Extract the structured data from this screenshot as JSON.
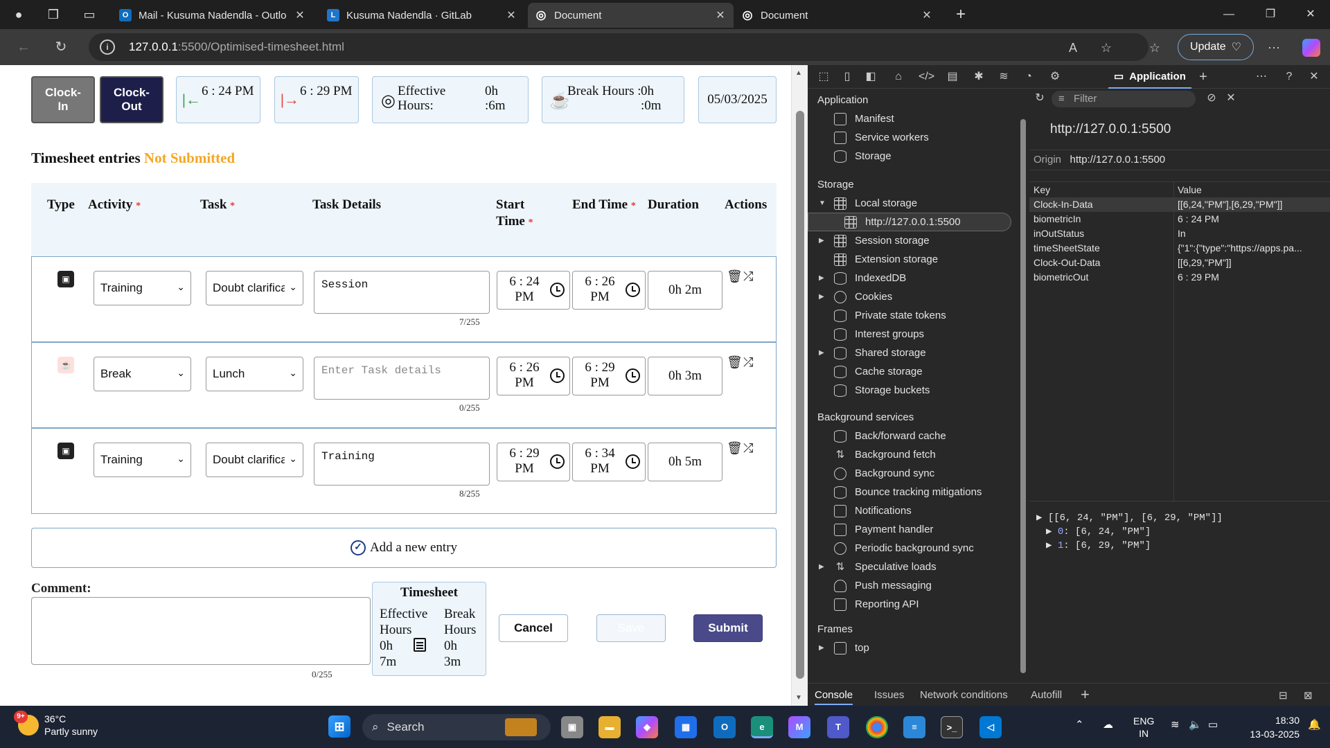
{
  "browser": {
    "tabs": [
      {
        "title": "Mail - Kusuma Nadendla - Outlook",
        "color": "#0f6cbd",
        "glyph": "O"
      },
      {
        "title": "Kusuma Nadendla · GitLab",
        "color": "#1f75cb",
        "glyph": "L"
      },
      {
        "title": "Document",
        "color": "#555555",
        "glyph": "◎"
      },
      {
        "title": "Document",
        "color": "#555555",
        "glyph": "◎"
      }
    ],
    "url_host": "127.0.0.1",
    "url_rest": ":5500/Optimised-timesheet.html",
    "update_label": "Update"
  },
  "page": {
    "clock_in_label": "Clock-In",
    "clock_out_label": "Clock-Out",
    "clock_in_time": "6 : 24 PM",
    "clock_out_time": "6 : 29 PM",
    "effective_label": "Effective Hours:",
    "effective_h": "0h",
    "effective_m": ":6m",
    "break_label": "Break Hours :",
    "break_h": "0h",
    "break_m": ":0m",
    "date": "05/03/2025",
    "timesheet_title": "Timesheet entries",
    "timesheet_status": "Not Submitted",
    "columns": {
      "type": "Type",
      "activity": "Activity",
      "task": "Task",
      "details": "Task Details",
      "start_1": "Start",
      "start_2": "Time",
      "end": "End Time",
      "duration": "Duration",
      "actions": "Actions"
    },
    "required_mark": "*",
    "rows": [
      {
        "activity": "Training",
        "task": "Doubt clarification",
        "details": "Session",
        "details_placeholder": "",
        "count": "7/255",
        "start_1": "6 : 24",
        "start_2": "PM",
        "end_1": "6 : 26",
        "end_2": "PM",
        "duration": "0h 2m"
      },
      {
        "activity": "Break",
        "task": "Lunch",
        "details": "",
        "details_placeholder": "Enter Task details",
        "count": "0/255",
        "start_1": "6 : 26",
        "start_2": "PM",
        "end_1": "6 : 29",
        "end_2": "PM",
        "duration": "0h 3m"
      },
      {
        "activity": "Training",
        "task": "Doubt clarification",
        "details": "Training",
        "details_placeholder": "",
        "count": "8/255",
        "start_1": "6 : 29",
        "start_2": "PM",
        "end_1": "6 : 34",
        "end_2": "PM",
        "duration": "0h 5m"
      }
    ],
    "add_entry_label": "Add a new entry",
    "comment_label": "Comment:",
    "comment_count": "0/255",
    "summary": {
      "title": "Timesheet",
      "eff_1": "Effective",
      "eff_2": "Hours",
      "eff_3": "0h",
      "eff_4": "7m",
      "brk_1": "Break",
      "brk_2": "Hours",
      "brk_3": "0h",
      "brk_4": "3m"
    },
    "cancel_label": "Cancel",
    "save_label": "Save",
    "submit_label": "Submit"
  },
  "devtools": {
    "active_tab": "Application",
    "sidebar": {
      "application_header": "Application",
      "application_items": [
        "Manifest",
        "Service workers",
        "Storage"
      ],
      "storage_header": "Storage",
      "local_storage": "Local storage",
      "local_storage_origin": "http://127.0.0.1:5500",
      "storage_items": [
        "Session storage",
        "Extension storage",
        "IndexedDB",
        "Cookies",
        "Private state tokens",
        "Interest groups",
        "Shared storage",
        "Cache storage",
        "Storage buckets"
      ],
      "bg_header": "Background services",
      "bg_items": [
        "Back/forward cache",
        "Background fetch",
        "Background sync",
        "Bounce tracking mitigations",
        "Notifications",
        "Payment handler",
        "Periodic background sync",
        "Speculative loads",
        "Push messaging",
        "Reporting API"
      ],
      "frames_header": "Frames",
      "frames_top": "top"
    },
    "filter_placeholder": "Filter",
    "origin_title": "http://127.0.0.1:5500",
    "origin_label": "Origin",
    "origin_value": "http://127.0.0.1:5500",
    "table": {
      "key_header": "Key",
      "value_header": "Value",
      "rows": [
        {
          "key": "Clock-In-Data",
          "value": "[[6,24,\"PM\"],[6,29,\"PM\"]]"
        },
        {
          "key": "biometricIn",
          "value": "6 : 24 PM"
        },
        {
          "key": "inOutStatus",
          "value": "In"
        },
        {
          "key": "timeSheetState",
          "value": "{\"1\":{\"type\":\"https://apps.pa..."
        },
        {
          "key": "Clock-Out-Data",
          "value": "[[6,29,\"PM\"]]"
        },
        {
          "key": "biometricOut",
          "value": "6 : 29 PM"
        }
      ]
    },
    "preview": {
      "line1": "[[6, 24, \"PM\"], [6, 29, \"PM\"]]",
      "idx0": "0",
      "line2": ": [6, 24, \"PM\"]",
      "idx1": "1",
      "line3": ": [6, 29, \"PM\"]"
    },
    "drawer_tabs": [
      "Console",
      "Issues",
      "Network conditions",
      "Autofill"
    ]
  },
  "taskbar": {
    "temp": "36°C",
    "weather": "Partly sunny",
    "badge": "9+",
    "search_label": "Search",
    "lang_1": "ENG",
    "lang_2": "IN",
    "time": "18:30",
    "date": "13-03-2025"
  },
  "colors": {
    "clock_in_bg": "#777777",
    "clock_out_bg": "#1e1e4a",
    "submit_bg": "#4a4a8a",
    "status_orange": "#f5a623",
    "accent_blue": "#7cacf8"
  }
}
